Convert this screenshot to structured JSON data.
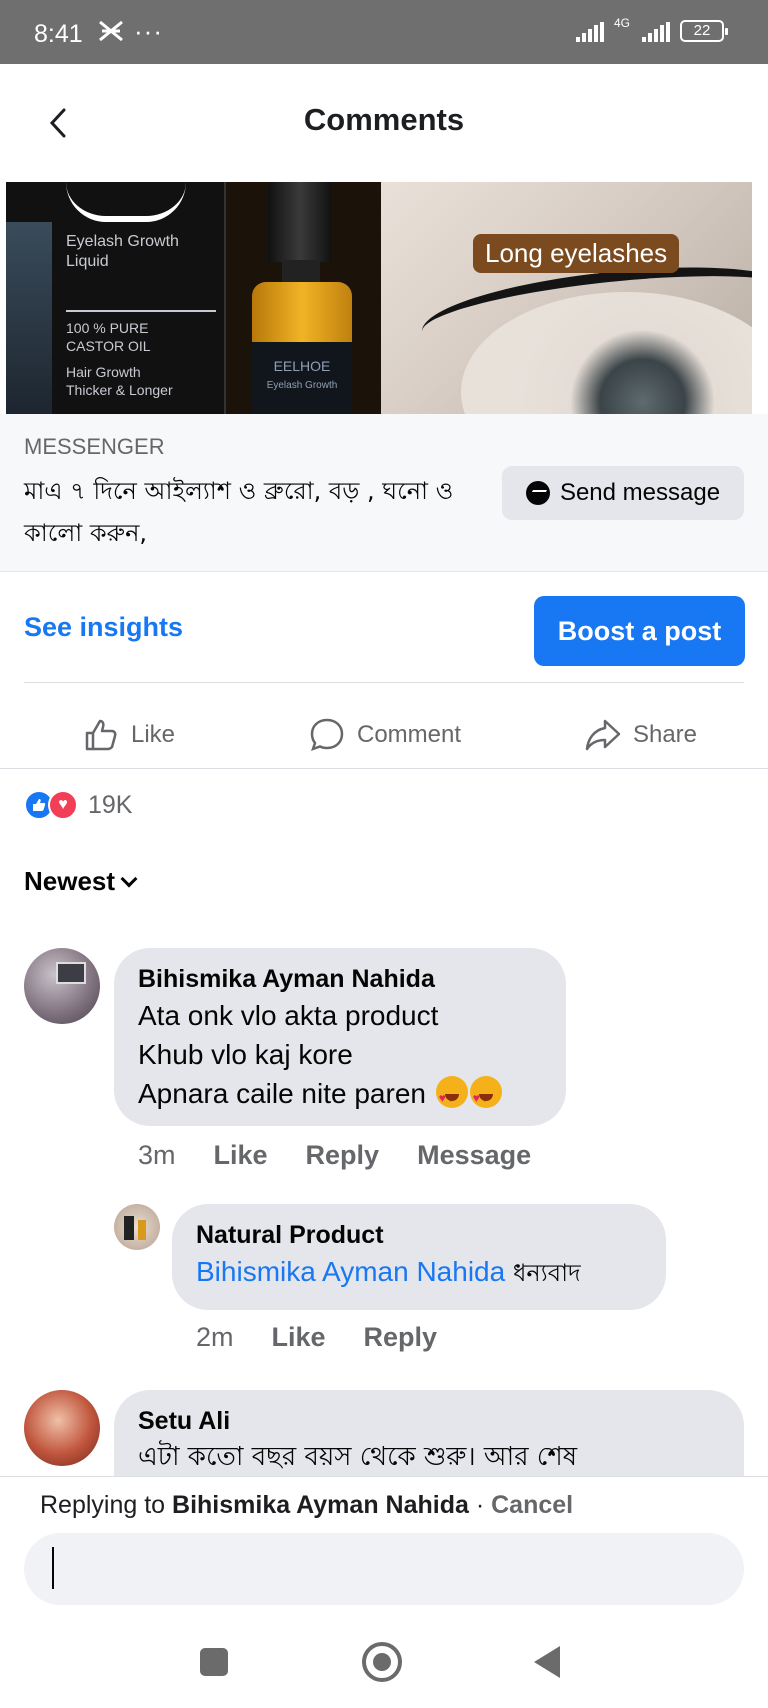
{
  "status_bar": {
    "time": "8:41",
    "notification_icon": "notification-icon",
    "more_dots": "···",
    "network": "4G",
    "battery": "22"
  },
  "header": {
    "title": "Comments"
  },
  "ad_image": {
    "box_brand_line1": "Eyelash Growth",
    "box_brand_line2": "Liquid",
    "box_line3": "100 % PURE",
    "box_line4": "CASTOR OIL",
    "box_line5": "Hair Growth",
    "box_line6": "Thicker & Longer",
    "bottle_brand": "EELHOE",
    "bottle_sub": "Eyelash Growth",
    "tag": "Long eyelashes"
  },
  "cta": {
    "label": "MESSENGER",
    "text": "মাএ ৭ দিনে আইল্যাশ ও ব্রুরো, বড় , ঘনো ও কালো করুন,",
    "button": "Send message"
  },
  "insights": {
    "see_insights": "See insights",
    "boost": "Boost a post"
  },
  "actions": {
    "like": "Like",
    "comment": "Comment",
    "share": "Share"
  },
  "reactions": {
    "count": "19K"
  },
  "sort": {
    "label": "Newest"
  },
  "comments": [
    {
      "name": "Bihismika Ayman Nahida",
      "lines": [
        "Ata onk vlo akta product",
        "Khub vlo kaj kore",
        "Apnara caile nite paren"
      ],
      "time": "3m",
      "like": "Like",
      "reply": "Reply",
      "message": "Message"
    },
    {
      "name": "Natural Product",
      "mention": "Bihismika Ayman Nahida",
      "text": "ধন্যবাদ",
      "time": "2m",
      "like": "Like",
      "reply": "Reply"
    },
    {
      "name": "Setu Ali",
      "text": "এটা কতো বছর বয়স থেকে শুরু। আর শেষ"
    }
  ],
  "reply_bar": {
    "prefix": "Replying to",
    "target": "Bihismika Ayman Nahida",
    "separator": " · ",
    "cancel": "Cancel"
  },
  "colors": {
    "accent": "#1877f2",
    "bubble": "#e4e6eb",
    "muted": "#65676b"
  }
}
